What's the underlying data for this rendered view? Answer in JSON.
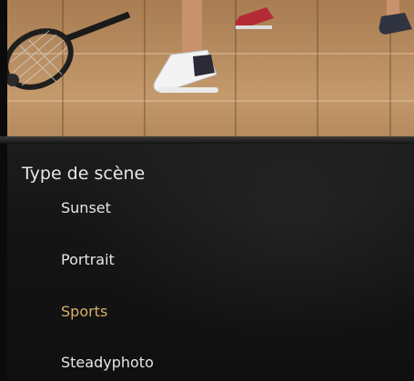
{
  "menu": {
    "title": "Type de scène",
    "items": [
      {
        "label": "Sunset",
        "selected": false
      },
      {
        "label": "Portrait",
        "selected": false
      },
      {
        "label": "Sports",
        "selected": true
      },
      {
        "label": "Steadyphoto",
        "selected": false
      }
    ]
  },
  "colors": {
    "selected_item": "#d8b06a",
    "item_text": "#e6e6e6",
    "panel_bg": "#141414"
  }
}
